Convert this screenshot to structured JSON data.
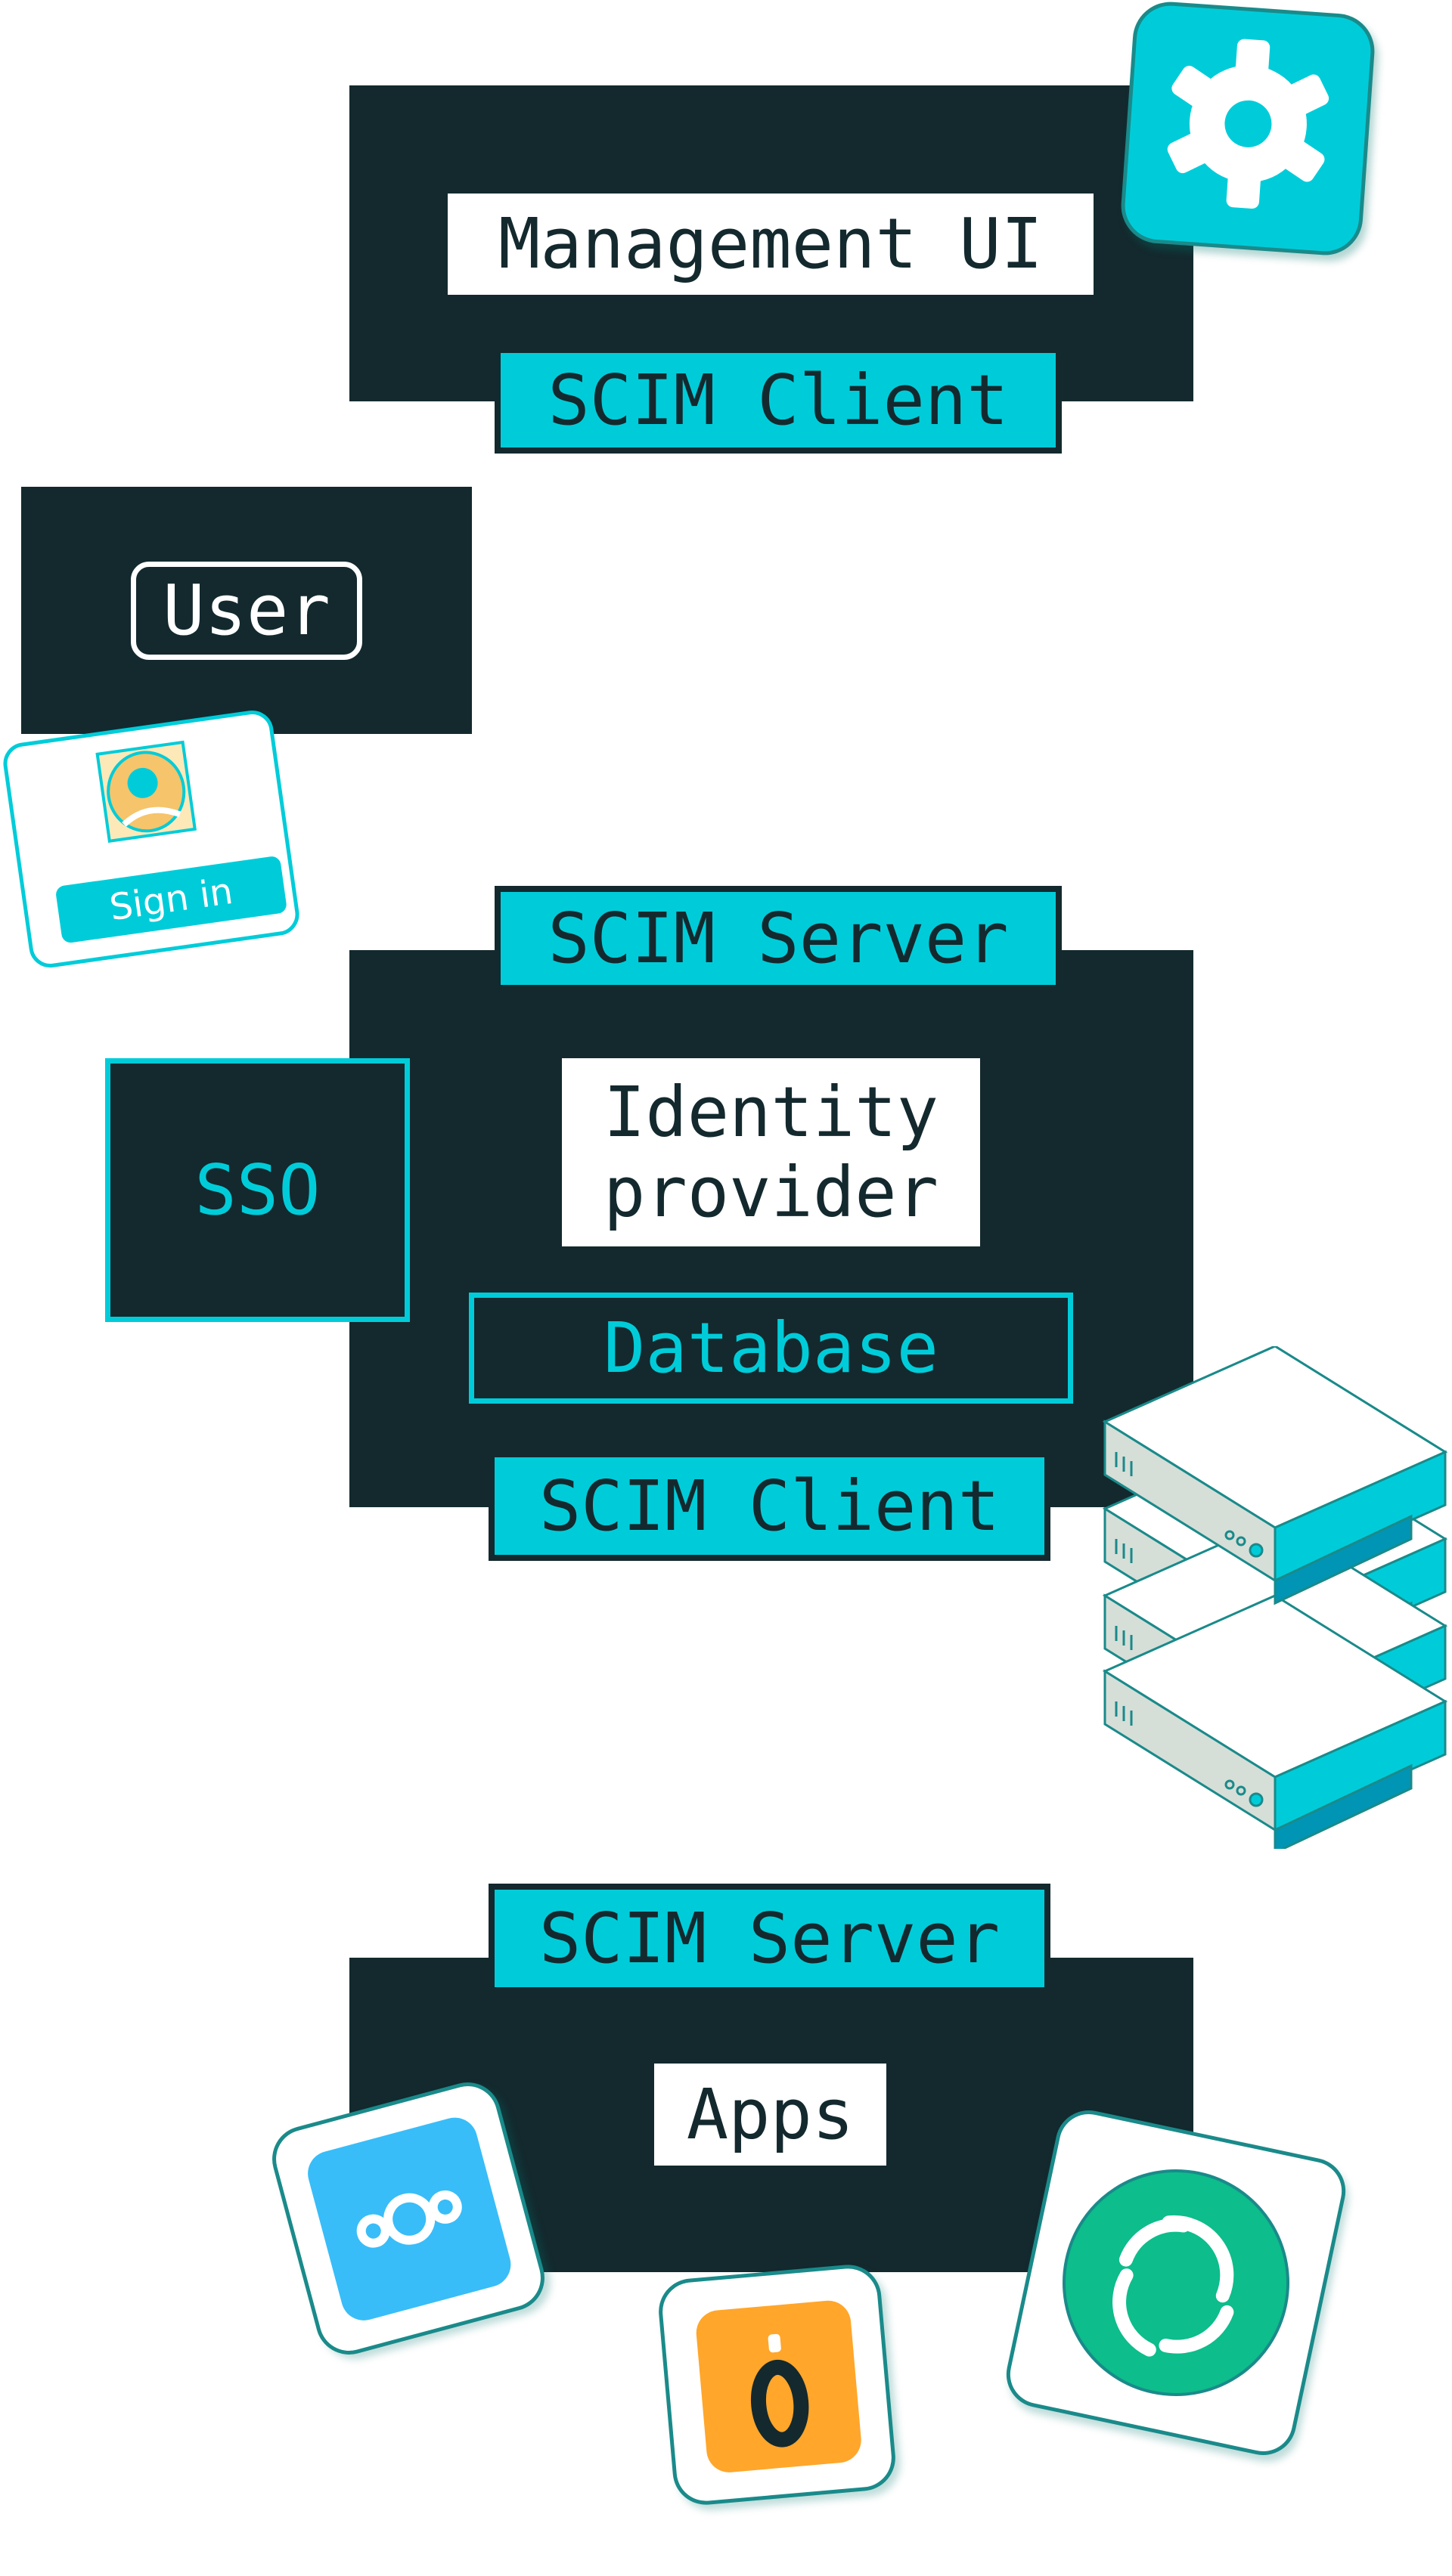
{
  "colors": {
    "dark": "#13292e",
    "accent": "#00ccd9",
    "nextcloud": "#38bdf8",
    "orange": "#ffa62b",
    "element": "#0dbd8b"
  },
  "management": {
    "title": "Management UI",
    "client": "SCIM Client",
    "icon": "gear-icon"
  },
  "user": {
    "label": "User",
    "signin": "Sign in",
    "icon": "avatar-icon"
  },
  "identity": {
    "server": "SCIM Server",
    "sso": "SSO",
    "title": "Identity\nprovider",
    "database": "Database",
    "client": "SCIM Client",
    "icon": "server-stack-icon"
  },
  "apps": {
    "server": "SCIM Server",
    "title": "Apps",
    "icons": [
      "nextcloud-icon",
      "openproject-icon",
      "element-icon"
    ]
  }
}
